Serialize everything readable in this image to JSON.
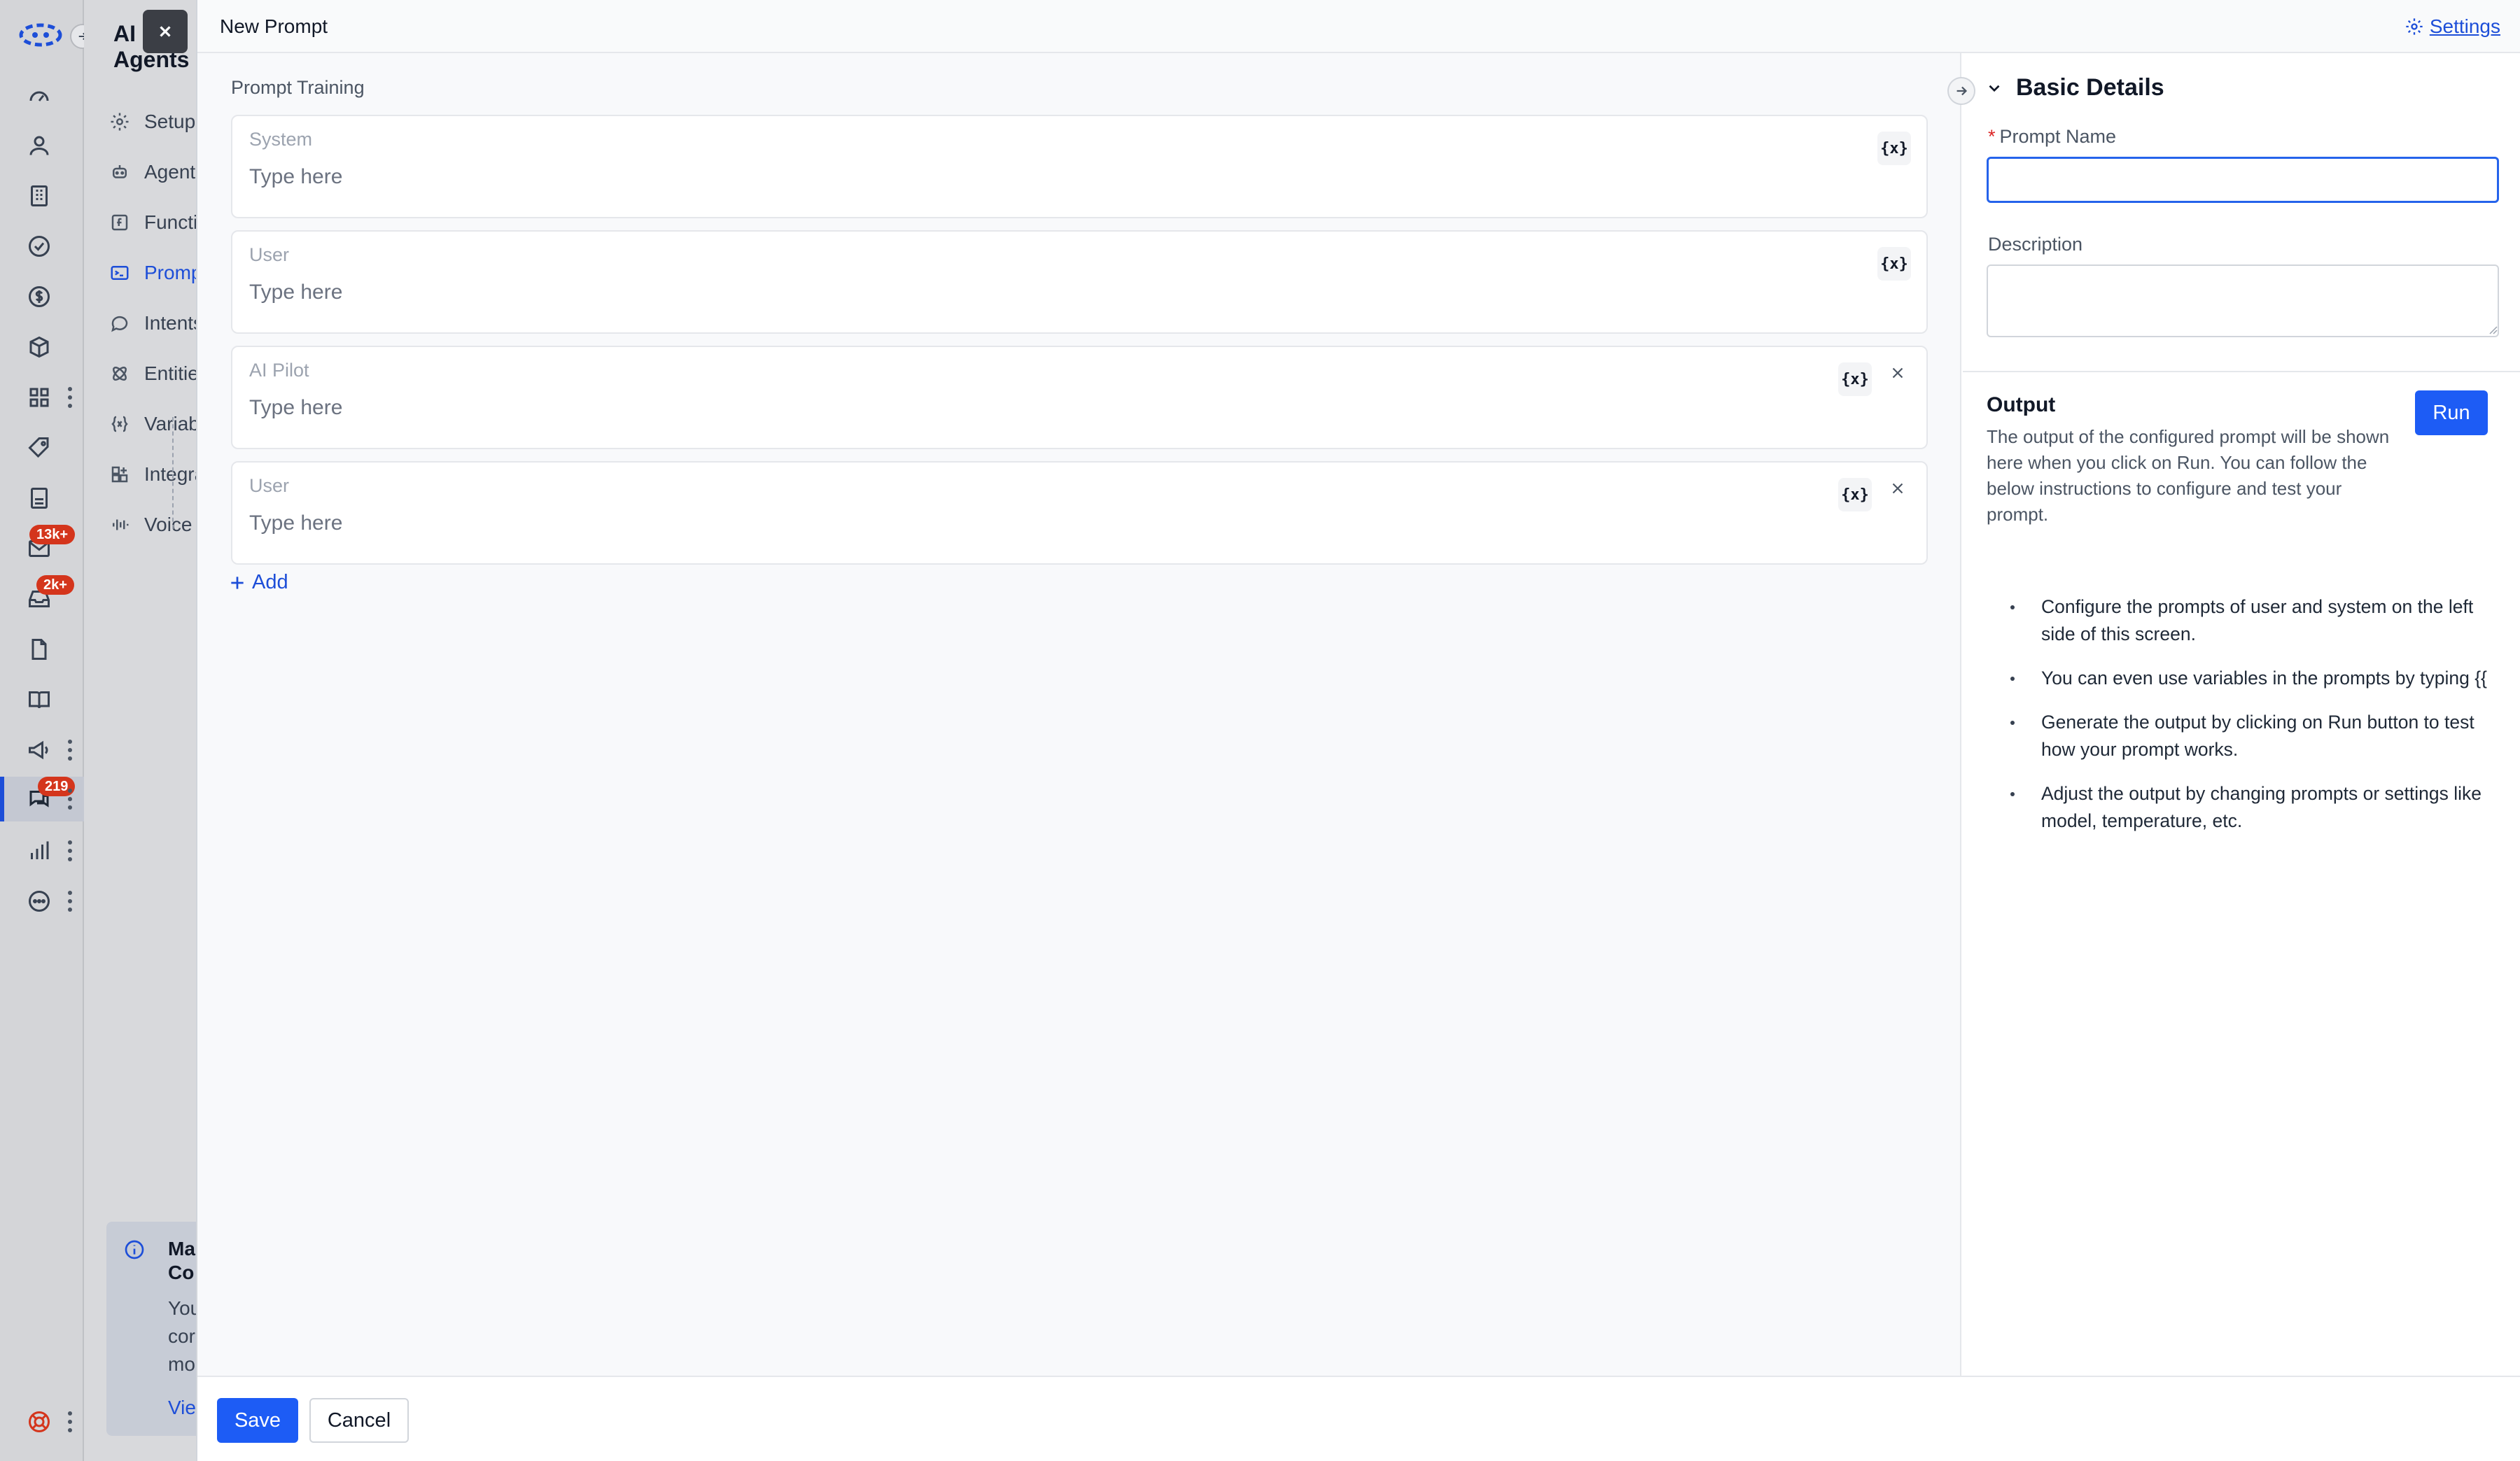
{
  "background": {
    "app_title": "AI Agents",
    "nav_items": [
      {
        "label": "Setup",
        "icon": "gear-icon"
      },
      {
        "label": "Agents",
        "icon": "agent-icon"
      },
      {
        "label": "Functions",
        "icon": "function-icon"
      },
      {
        "label": "Prompts",
        "icon": "terminal-icon",
        "active": true
      },
      {
        "label": "Intents",
        "icon": "chat-bubble-icon"
      },
      {
        "label": "Entities",
        "icon": "entities-icon"
      },
      {
        "label": "Variables",
        "icon": "variable-icon"
      },
      {
        "label": "Integrations",
        "icon": "integration-icon"
      },
      {
        "label": "Voice",
        "icon": "voice-icon"
      }
    ],
    "info_card": {
      "title": "Ma\nCo",
      "desc": "You\ncor\nmo",
      "link": "Vie"
    },
    "badges": {
      "inbox": "13k+",
      "tickets": "2k+",
      "chats": "219"
    }
  },
  "modal": {
    "title": "New Prompt",
    "settings_label": "Settings",
    "section_label": "Prompt Training",
    "prompts": [
      {
        "role": "System",
        "placeholder": "Type here",
        "deletable": false
      },
      {
        "role": "User",
        "placeholder": "Type here",
        "deletable": false
      },
      {
        "role": "AI Pilot",
        "placeholder": "Type here",
        "deletable": true
      },
      {
        "role": "User",
        "placeholder": "Type here",
        "deletable": true
      }
    ],
    "variable_button_label": "{x}",
    "add_label": "Add",
    "basic_details": {
      "heading": "Basic Details",
      "name_label": "Prompt Name",
      "name_value": "",
      "description_label": "Description",
      "description_value": ""
    },
    "output": {
      "title": "Output",
      "run_label": "Run",
      "description": "The output of the configured prompt will be shown here when you click on Run. You can follow the below instructions to configure and test your prompt.",
      "instructions": [
        "Configure the prompts of user and system on the left side of this screen.",
        "You can even use variables in the prompts by typing {{",
        "Generate the output by clicking on Run button to test how your prompt works.",
        "Adjust the output by changing prompts or settings like model, temperature, etc."
      ]
    },
    "footer": {
      "save_label": "Save",
      "cancel_label": "Cancel"
    }
  },
  "colors": {
    "accent": "#1d5cf5",
    "badge": "#d4351c",
    "required": "#dc2626"
  }
}
